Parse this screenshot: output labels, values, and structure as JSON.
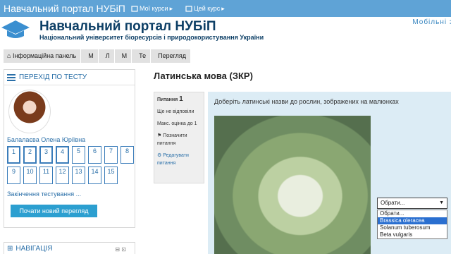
{
  "topbar": {
    "brand": "Навчальний портал НУБіП",
    "menu": [
      {
        "label": "Мої курси",
        "icon": "book-icon"
      },
      {
        "label": "Цей курс",
        "icon": "book-icon"
      }
    ]
  },
  "header": {
    "title": "Навчальний портал НУБіП",
    "subtitle": "Національний університет біоресурсів і природокористування України",
    "mobile": "Мобільні за"
  },
  "breadcrumb": [
    "Інформаційна панель",
    "М",
    "Л",
    "М",
    "Те",
    "Перегляд"
  ],
  "quiz_nav": {
    "title": "ПЕРЕХІД ПО ТЕСТУ",
    "user_name": "Балалаєва Олена Юріївна",
    "questions": [
      "1",
      "2",
      "3",
      "4",
      "5",
      "6",
      "7",
      "8",
      "9",
      "10",
      "11",
      "12",
      "13",
      "14",
      "15"
    ],
    "finish_link": "Закінчення тестування ...",
    "new_attempt": "Почати новий перегляд"
  },
  "navigation": {
    "title": "НАВІГАЦІЯ"
  },
  "page": {
    "title": "Латинська мова (ЗКР)"
  },
  "question_info": {
    "label": "Питання",
    "number": "1",
    "status": "Ще не відповіли",
    "max_label": "Макс. оцінка до 1",
    "flag": "Позначити питання",
    "edit": "Редагувати питання"
  },
  "question": {
    "text": "Доберіть латинські назви до рослин, зображених на малюнках",
    "select_value": "Обрати...",
    "options": [
      "Обрати...",
      "Brassica oleracea",
      "Solanum tuberosum",
      "Beta vulgaris"
    ],
    "highlighted": "Brassica oleracea"
  },
  "colors": {
    "accent": "#5fa3d6",
    "link": "#2a6fa8",
    "button": "#2c9fd0",
    "question_bg": "#dcecf5"
  }
}
